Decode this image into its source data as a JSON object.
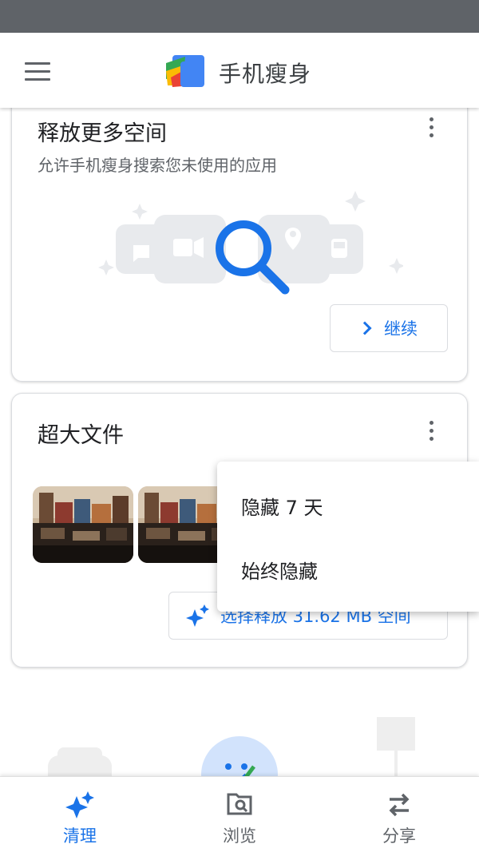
{
  "app_bar": {
    "title": "手机瘦身",
    "menu_icon": "hamburger-menu-icon",
    "logo_icon": "files-app-logo"
  },
  "unused_apps_card": {
    "title": "释放更多空间",
    "subtitle": "允许手机瘦身搜索您未使用的应用",
    "continue_label": "继续"
  },
  "large_files_card": {
    "title": "超大文件",
    "free_label": "选择释放 31.62 MB 空间"
  },
  "overflow_menu": {
    "items": [
      "隐藏 7 天",
      "始终隐藏"
    ]
  },
  "bottom_nav": {
    "items": [
      {
        "label": "清理",
        "icon": "sparkle-icon",
        "active": true
      },
      {
        "label": "浏览",
        "icon": "browse-folder-icon",
        "active": false
      },
      {
        "label": "分享",
        "icon": "swap-arrows-icon",
        "active": false
      }
    ]
  },
  "colors": {
    "accent": "#1a73e8",
    "text_primary": "#202124",
    "text_secondary": "#5f6368",
    "status_bar": "#5f6368"
  }
}
